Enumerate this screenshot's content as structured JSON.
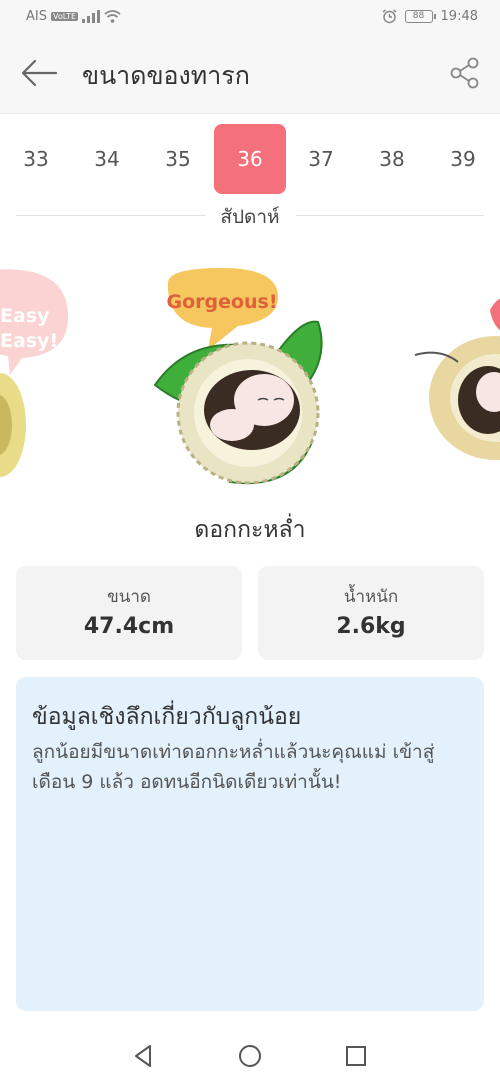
{
  "status_bar": {
    "carrier": "AIS",
    "volte": "VoLTE",
    "battery": "88",
    "time": "19:48"
  },
  "header": {
    "title": "ขนาดของทารก"
  },
  "weeks": {
    "items": [
      "33",
      "34",
      "35",
      "36",
      "37",
      "38",
      "39"
    ],
    "selected": "36",
    "label": "สัปดาห์"
  },
  "carousel": {
    "main_bubble": "Gorgeous!",
    "left_bubble_line1": "Easy",
    "left_bubble_line2": "Easy!"
  },
  "fruit": {
    "name": "ดอกกะหล่ำ"
  },
  "stats": {
    "size_label": "ขนาด",
    "size_value": "47.4cm",
    "weight_label": "น้ำหนัก",
    "weight_value": "2.6kg"
  },
  "info": {
    "title": "ข้อมูลเชิงลึกเกี่ยวกับลูกน้อย",
    "body": "ลูกน้อยมีขนาดเท่าดอกกะหล่ำแล้วนะคุณแม่ เข้าสู่เดือน 9 แล้ว อดทนอีกนิดเดียวเท่านั้น!"
  },
  "colors": {
    "accent": "#f4707a",
    "info_bg": "#e3f1fc",
    "card_bg": "#f3f3f3",
    "leaf": "#3fae3a",
    "bubble": "#f6c75e"
  },
  "icons": {
    "back": "arrow-left-icon",
    "share": "share-icon",
    "nav_back": "triangle-back-icon",
    "nav_home": "circle-home-icon",
    "nav_recent": "square-recent-icon"
  }
}
